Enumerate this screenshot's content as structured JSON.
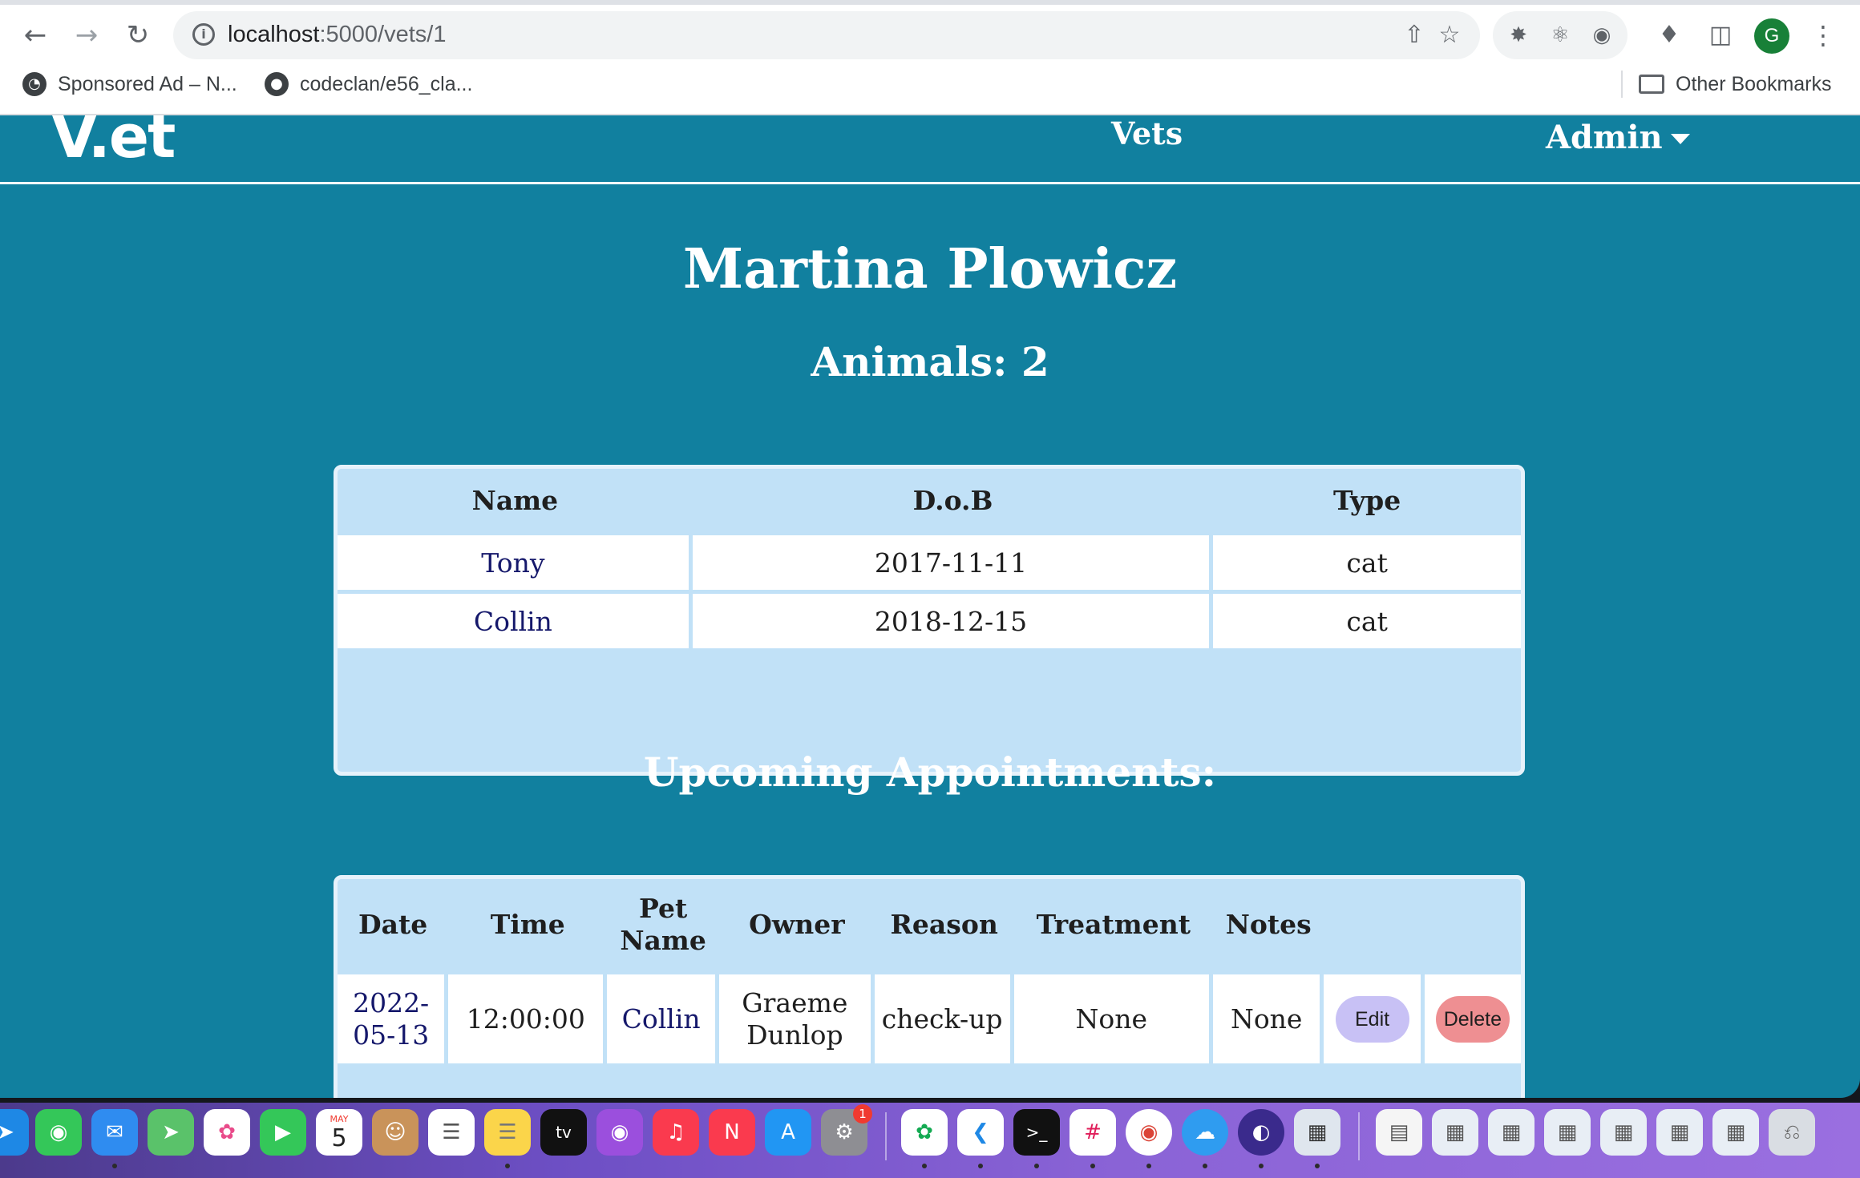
{
  "browser": {
    "url_host": "localhost",
    "url_path": ":5000/vets/1",
    "profile_initial": "G",
    "bookmarks": [
      {
        "label": "Sponsored Ad – N..."
      },
      {
        "label": "codeclan/e56_cla..."
      }
    ],
    "other_bookmarks": "Other Bookmarks"
  },
  "site": {
    "brand": "V.et",
    "nav_vets": "Vets",
    "nav_admin": "Admin"
  },
  "vet": {
    "name": "Martina Plowicz",
    "animals_label": "Animals: 2"
  },
  "animals_table": {
    "headers": [
      "Name",
      "D.o.B",
      "Type"
    ],
    "rows": [
      {
        "name": "Tony",
        "dob": "2017-11-11",
        "type": "cat"
      },
      {
        "name": "Collin",
        "dob": "2018-12-15",
        "type": "cat"
      }
    ]
  },
  "appointments": {
    "heading": "Upcoming Appointments:",
    "headers": [
      "Date",
      "Time",
      "Pet Name",
      "Owner",
      "Reason",
      "Treatment",
      "Notes"
    ],
    "rows": [
      {
        "date": "2022-05-13",
        "time": "12:00:00",
        "pet": "Collin",
        "owner": "Graeme Dunlop",
        "reason": "check-up",
        "treatment": "None",
        "notes": "None",
        "edit_label": "Edit",
        "delete_label": "Delete"
      }
    ]
  },
  "dock": {
    "calendar_month": "MAY",
    "calendar_day": "5",
    "settings_badge": "1",
    "apps": [
      "safari-icon",
      "messages-icon",
      "mail-icon",
      "maps-icon",
      "photos-icon",
      "facetime-icon",
      "calendar-icon",
      "contacts-icon",
      "reminders-icon",
      "notes-icon",
      "apple-tv-icon",
      "podcasts-icon",
      "music-icon",
      "news-icon",
      "app-store-icon",
      "system-preferences-icon",
      "mongodb-compass-icon",
      "vscode-icon",
      "terminal-icon",
      "slack-icon",
      "chrome-icon",
      "postico-icon",
      "timer-icon",
      "preview-icon"
    ]
  }
}
